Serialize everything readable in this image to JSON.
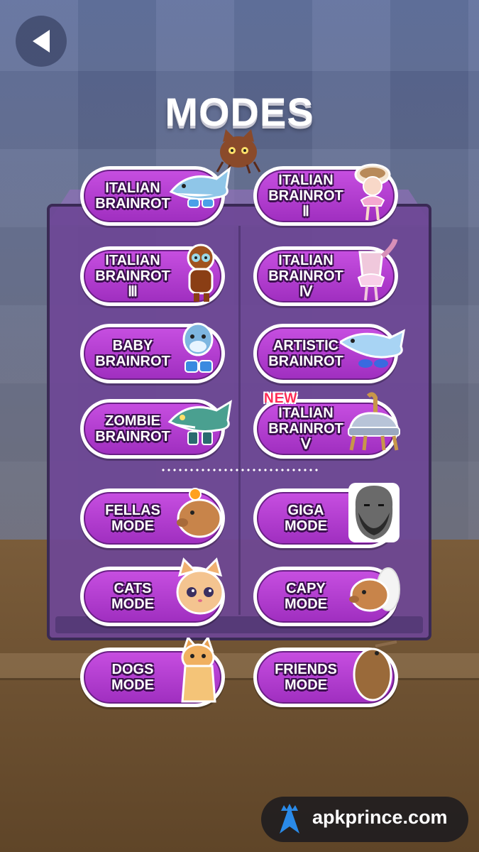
{
  "title": "MODES",
  "modes": [
    {
      "line1": "ITALIAN",
      "line2": "BRAINROT",
      "icon": "shark-icon"
    },
    {
      "line1": "ITALIAN",
      "line2": "BRAINROT Ⅱ",
      "icon": "coffee-ballerina-icon"
    },
    {
      "line1": "ITALIAN",
      "line2": "BRAINROT Ⅲ",
      "icon": "monkey-icon"
    },
    {
      "line1": "ITALIAN",
      "line2": "BRAINROT Ⅳ",
      "icon": "cup-ballerina-icon"
    },
    {
      "line1": "BABY",
      "line2": "BRAINROT",
      "icon": "baby-shark-icon"
    },
    {
      "line1": "ARTISTIC",
      "line2": "BRAINROT",
      "icon": "sketch-shark-icon"
    },
    {
      "line1": "ZOMBIE",
      "line2": "BRAINROT",
      "icon": "zombie-shark-icon"
    },
    {
      "line1": "ITALIAN",
      "line2": "BRAINROT Ⅴ",
      "icon": "camel-car-icon",
      "badge": "NEW"
    },
    {
      "line1": "FELLAS",
      "line2": "MODE",
      "icon": "capybara-orange-icon"
    },
    {
      "line1": "GIGA",
      "line2": "MODE",
      "icon": "bearded-man-icon"
    },
    {
      "line1": "CATS",
      "line2": "MODE",
      "icon": "cat-face-icon"
    },
    {
      "line1": "CAPY",
      "line2": "MODE",
      "icon": "capybara-bird-icon"
    },
    {
      "line1": "DOGS",
      "line2": "MODE",
      "icon": "shiba-dog-icon"
    },
    {
      "line1": "FRIENDS",
      "line2": "MODE",
      "icon": "kiwi-bird-icon"
    }
  ],
  "watermark": "apkprince.com",
  "colors": {
    "button_purple": "#b33fd1",
    "box_purple": "#6e4696",
    "new_badge": "#ff2a55"
  }
}
